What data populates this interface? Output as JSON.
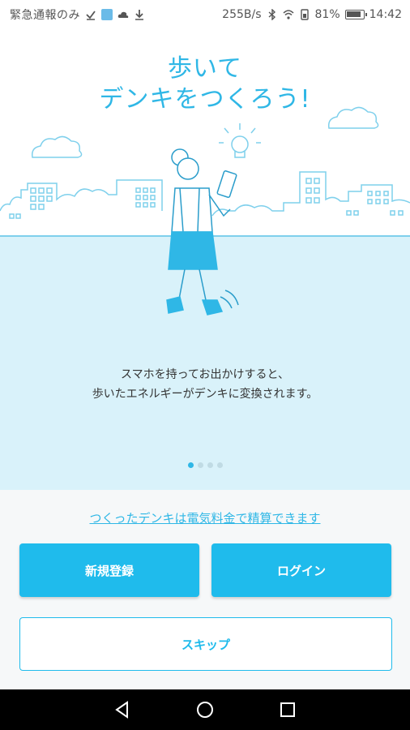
{
  "status_bar": {
    "left_text": "緊急通報のみ",
    "net_speed": "255B/s",
    "battery_pct": "81%",
    "time": "14:42",
    "icons": [
      "check-icon",
      "app-icon",
      "cloud-icon",
      "download-icon",
      "bluetooth-icon",
      "wifi-icon",
      "sim-icon",
      "battery-icon"
    ]
  },
  "hero": {
    "title_line1": "歩いて",
    "title_line2": "デンキをつくろう!",
    "description_line1": "スマホを持ってお出かけすると、",
    "description_line2": "歩いたエネルギーがデンキに変換されます。",
    "page_indicator": {
      "total": 4,
      "active": 0
    }
  },
  "bottom": {
    "link_text": "つくったデンキは電気料金で精算できます",
    "signup_label": "新規登録",
    "login_label": "ログイン",
    "skip_label": "スキップ"
  },
  "nav_bar": {
    "buttons": [
      "back-icon",
      "home-icon",
      "recents-icon"
    ]
  },
  "colors": {
    "accent": "#1fbbec",
    "title": "#2fb7e6",
    "ground": "#d9f2fa",
    "line": "#7fd0ec"
  }
}
